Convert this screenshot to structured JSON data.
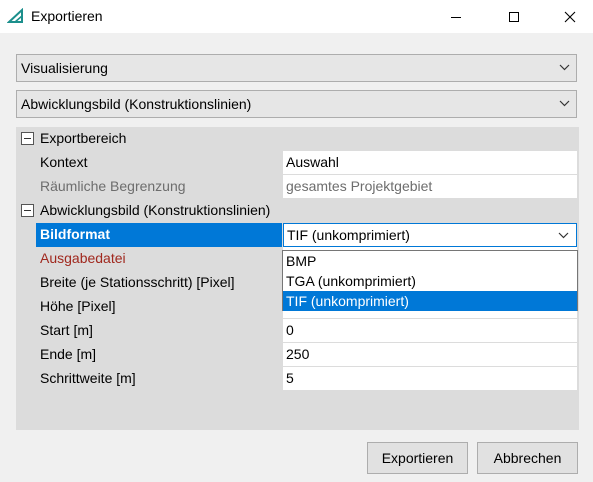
{
  "window": {
    "title": "Exportieren"
  },
  "combos": {
    "first": "Visualisierung",
    "second": "Abwicklungsbild (Konstruktionslinien)"
  },
  "grid": {
    "categories": [
      {
        "label": "Exportbereich"
      },
      {
        "label": "Abwicklungsbild (Konstruktionslinien)"
      }
    ],
    "rows": [
      {
        "name": "Kontext",
        "value": "Auswahl"
      },
      {
        "name": "Räumliche Begrenzung",
        "value": "gesamtes Projektgebiet"
      },
      {
        "name": "Bildformat",
        "value": "TIF (unkomprimiert)"
      },
      {
        "name": "Ausgabedatei",
        "value": ""
      },
      {
        "name": "Breite (je Stationsschritt) [Pixel]",
        "value": ""
      },
      {
        "name": "Höhe [Pixel]",
        "value": ""
      },
      {
        "name": "Start [m]",
        "value": "0"
      },
      {
        "name": "Ende [m]",
        "value": "250"
      },
      {
        "name": "Schrittweite [m]",
        "value": "5"
      }
    ]
  },
  "dropdown": {
    "options": [
      "BMP",
      "TGA (unkomprimiert)",
      "TIF (unkomprimiert)"
    ],
    "selected": "TIF (unkomprimiert)"
  },
  "buttons": {
    "export": "Exportieren",
    "cancel": "Abbrechen"
  },
  "colors": {
    "selection": "#0078d7",
    "error_label": "#a0281e",
    "accent_icon": "#1c8f8c"
  },
  "icons": {
    "app": "triangle-ruler-icon",
    "minimize": "minimize-icon",
    "maximize": "maximize-icon",
    "close": "close-icon",
    "expander": "collapse-minus-icon",
    "combo_arrow": "chevron-down-icon"
  }
}
